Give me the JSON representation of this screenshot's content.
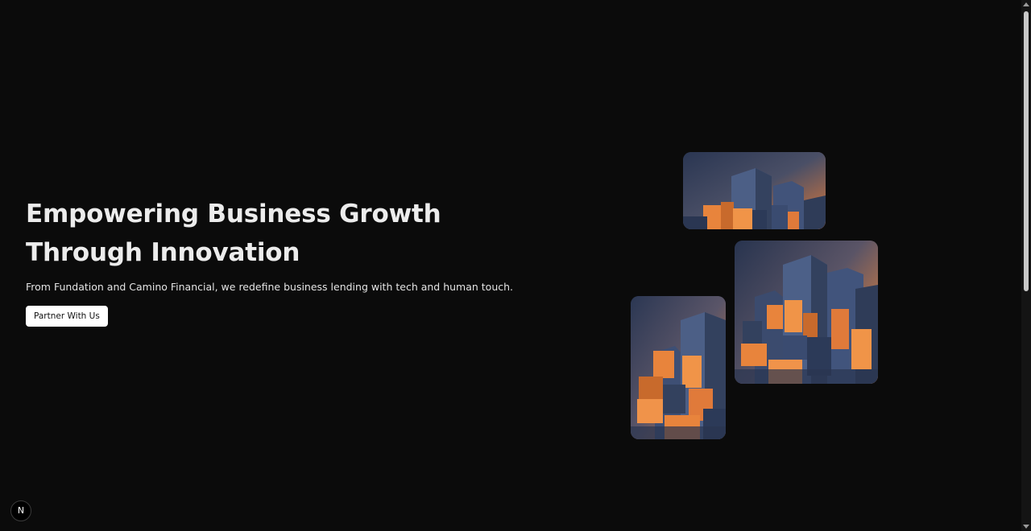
{
  "hero": {
    "title": "Empowering Business Growth Through Innovation",
    "subtitle": "From Fundation and Camino Financial, we redefine business lending with tech and human touch.",
    "cta_label": "Partner With Us"
  },
  "badge": {
    "letter": "N"
  },
  "colors": {
    "background": "#0b0b0b",
    "accent_orange": "#e8843c",
    "slate_blue": "#3a4a6a",
    "button_bg": "#ffffff"
  },
  "images": [
    {
      "name": "abstract-cubes-wide",
      "icon": "abstract-blocks-image"
    },
    {
      "name": "abstract-cubes-square",
      "icon": "abstract-blocks-image"
    },
    {
      "name": "abstract-cubes-tall",
      "icon": "abstract-blocks-image"
    }
  ]
}
